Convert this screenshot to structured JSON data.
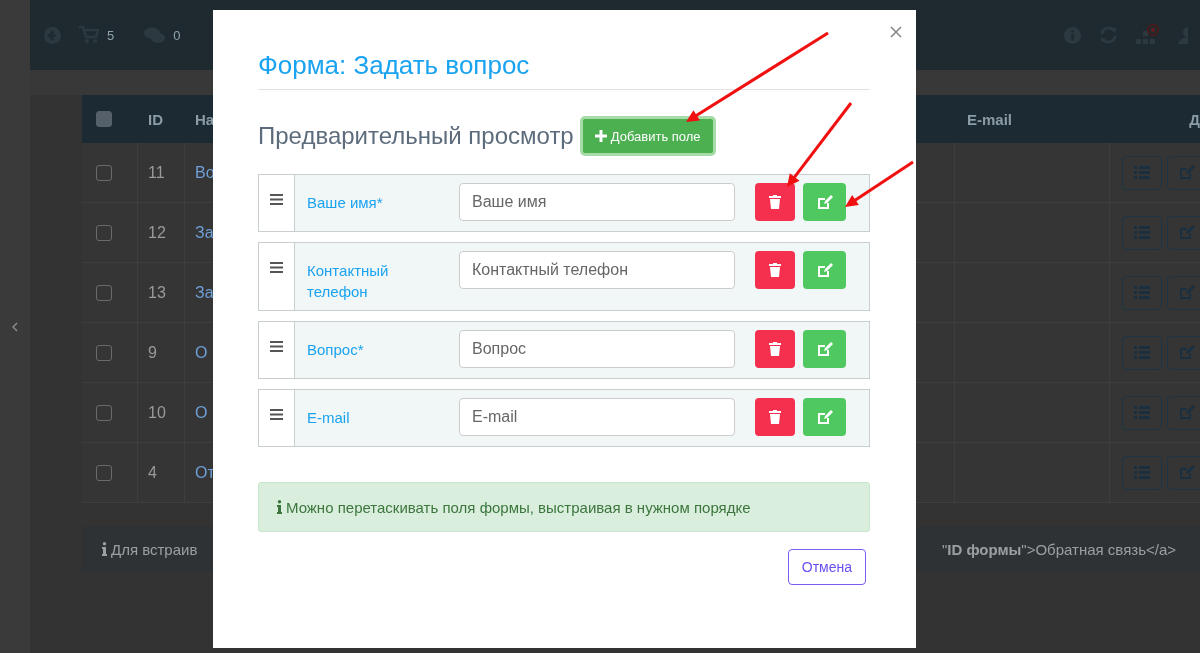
{
  "topbar": {
    "cart_count": "5",
    "messages_count": "0"
  },
  "table": {
    "select_all_checked": false,
    "columns": [
      "ID",
      "На",
      "E-mail",
      "Д"
    ],
    "rows": [
      {
        "checked": false,
        "id": "11",
        "name": "Во"
      },
      {
        "checked": false,
        "id": "12",
        "name": "За"
      },
      {
        "checked": false,
        "id": "13",
        "name": "За"
      },
      {
        "checked": false,
        "id": "9",
        "name": "О"
      },
      {
        "checked": false,
        "id": "10",
        "name": "О"
      },
      {
        "checked": false,
        "id": "4",
        "name": "От"
      }
    ]
  },
  "embed_note": {
    "lead": "Для встраив",
    "code": "\"**ID формы**\">Обратная связь</a>"
  },
  "modal": {
    "title": "Форма: Задать вопрос",
    "preview_heading": "Предварительный просмотр",
    "add_button": "Добавить поле",
    "fields": [
      {
        "label": "Ваше имя*",
        "placeholder": "Ваше имя"
      },
      {
        "label": "Контактный телефон",
        "placeholder": "Контактный телефон"
      },
      {
        "label": "Вопрос*",
        "placeholder": "Вопрос"
      },
      {
        "label": "E-mail",
        "placeholder": "E-mail"
      }
    ],
    "note": "Можно перетаскивать поля формы, выстраивая в нужном порядке",
    "cancel_button": "Отмена"
  }
}
